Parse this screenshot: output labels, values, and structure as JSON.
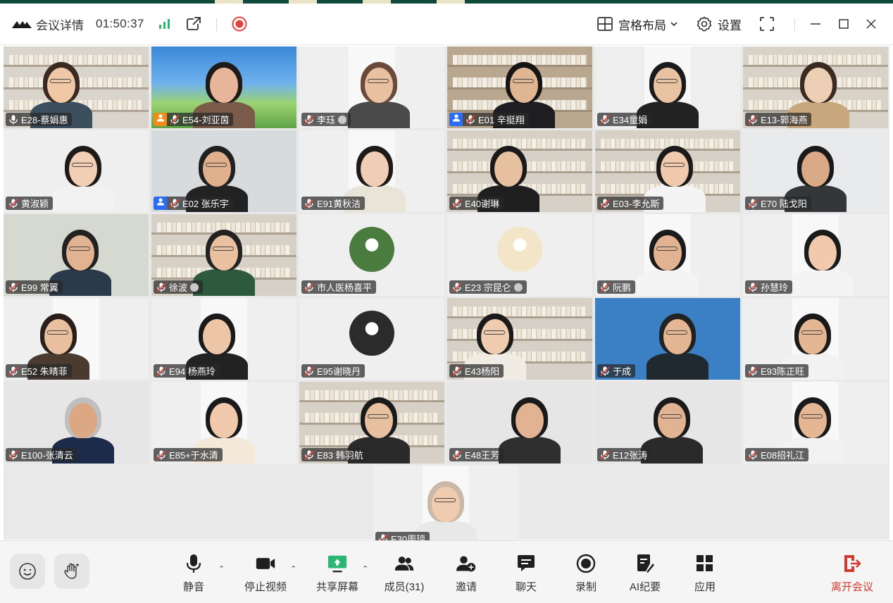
{
  "titlebar": {
    "meeting_details": "会议详情",
    "timer": "01:50:37",
    "layout_label": "宫格布局",
    "settings_label": "设置"
  },
  "colors": {
    "accent_green": "#2bb673",
    "record_red": "#e8413b",
    "leave_red": "#d33a2c",
    "role_orange": "#f08c1a",
    "role_blue": "#2a6cf5"
  },
  "participants": [
    {
      "name": "E28-蔡娟惠",
      "mic": "on",
      "active": true
    },
    {
      "name": "E54-刘亚茵",
      "mic": "muted",
      "role": "host"
    },
    {
      "name": "李珏",
      "mic": "muted",
      "external": true
    },
    {
      "name": "E01 辛挺翔",
      "mic": "muted",
      "role": "cohost"
    },
    {
      "name": "E34童娟",
      "mic": "muted"
    },
    {
      "name": "E13-郭海燕",
      "mic": "muted"
    },
    {
      "name": "黄淑颖",
      "mic": "muted"
    },
    {
      "name": "E02 张乐宇",
      "mic": "muted",
      "role": "cohost"
    },
    {
      "name": "E91黄秋洁",
      "mic": "muted"
    },
    {
      "name": "E40谢琳",
      "mic": "muted"
    },
    {
      "name": "E03-李允斯",
      "mic": "muted"
    },
    {
      "name": "E70 陆戈阳",
      "mic": "muted"
    },
    {
      "name": "E99 常翼",
      "mic": "muted"
    },
    {
      "name": "徐波",
      "mic": "muted",
      "external": true
    },
    {
      "name": "市人医杨喜平",
      "mic": "muted"
    },
    {
      "name": "E23 宗昆仑",
      "mic": "muted",
      "external": true
    },
    {
      "name": "阮鹏",
      "mic": "muted"
    },
    {
      "name": "孙慧玲",
      "mic": "muted"
    },
    {
      "name": "E52 朱晴菲",
      "mic": "muted"
    },
    {
      "name": "E94 杨燕玲",
      "mic": "muted"
    },
    {
      "name": "E95谢晓丹",
      "mic": "muted"
    },
    {
      "name": "E43杨阳",
      "mic": "muted"
    },
    {
      "name": "于成",
      "mic": "muted"
    },
    {
      "name": "E93陈正旺",
      "mic": "muted"
    },
    {
      "name": "E100-张清云",
      "mic": "muted"
    },
    {
      "name": "E85+于水清",
      "mic": "muted"
    },
    {
      "name": "E83 韩羽航",
      "mic": "muted"
    },
    {
      "name": "E48王芳",
      "mic": "muted"
    },
    {
      "name": "E12张涛",
      "mic": "muted"
    },
    {
      "name": "E08招礼江",
      "mic": "muted"
    },
    {
      "name": "E30周琼",
      "mic": "muted"
    }
  ],
  "toolbar": {
    "mute": "静音",
    "stop_video": "停止视频",
    "share_screen": "共享屏幕",
    "members": "成员(31)",
    "invite": "邀请",
    "chat": "聊天",
    "record": "录制",
    "ai_summary": "AI纪要",
    "apps": "应用",
    "leave": "离开会议"
  }
}
